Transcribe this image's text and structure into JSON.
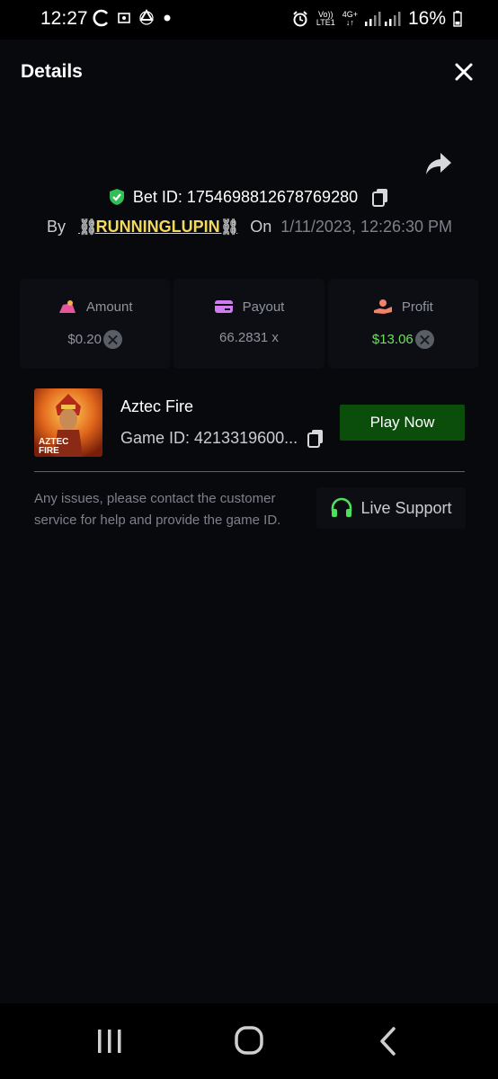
{
  "status_bar": {
    "time": "12:27",
    "battery": "16%",
    "network_top": "Vo))",
    "network_bottom": "LTE1",
    "network_type": "4G+",
    "icons": [
      "sync-icon",
      "gallery-icon",
      "recycle-icon",
      "dot-icon",
      "alarm-icon",
      "signal-icon",
      "battery-icon"
    ]
  },
  "header": {
    "title": "Details",
    "close_icon": "close-icon"
  },
  "bet": {
    "bet_id_text": "Bet ID: 1754698812678769280",
    "by_label": "By",
    "chain_left": "⛓",
    "username": "RUNNINGLUPIN",
    "chain_right": "⛓",
    "on_label": "On",
    "date": "1/11/2023, 12:26:30 PM"
  },
  "stats": {
    "amount": {
      "label": "Amount",
      "value": "$0.20"
    },
    "payout": {
      "label": "Payout",
      "value": "66.2831 x"
    },
    "profit": {
      "label": "Profit",
      "value": "$13.06"
    }
  },
  "game": {
    "name": "Aztec Fire",
    "game_id": "Game ID: 4213319600...",
    "thumb_line1": "AZTEC",
    "thumb_line2": "FIRE",
    "play_label": "Play Now"
  },
  "support": {
    "issue_text": "Any issues, please contact the customer service for help and provide the game ID.",
    "button_label": "Live Support"
  },
  "colors": {
    "accent_green": "#0b4e0c",
    "profit_green": "#6ee05a",
    "username_yellow": "#f2d95c",
    "shield_green": "#2fbf55"
  }
}
